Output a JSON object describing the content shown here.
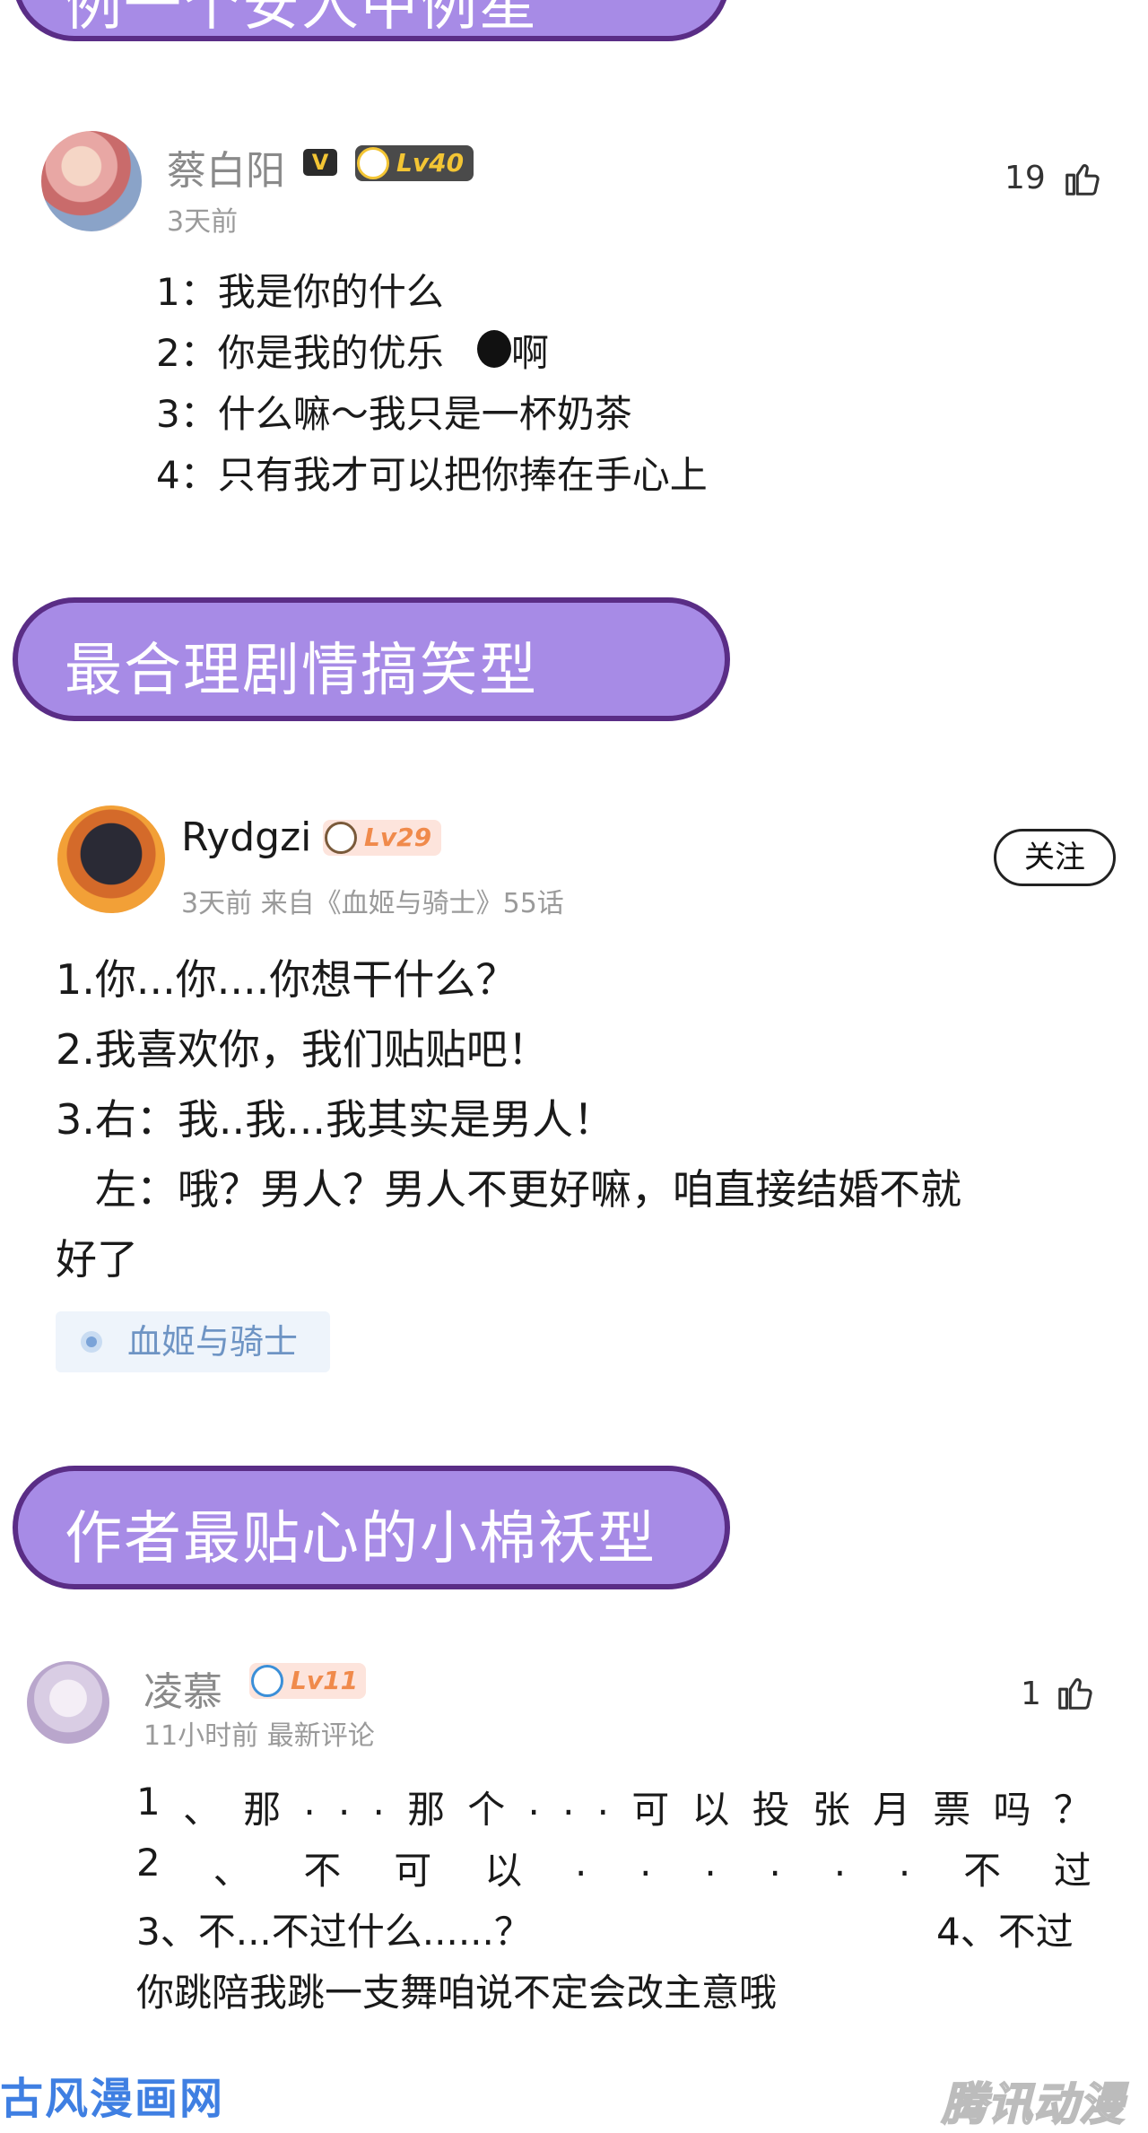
{
  "banners": {
    "top": "例一个安人中例星",
    "b1": "最合理剧情搞笑型",
    "b2": "作者最贴心的小棉袄型"
  },
  "comment1": {
    "username": "蔡白阳",
    "v_badge": "V",
    "level": "Lv40",
    "time": "3天前",
    "likes": "19",
    "lines": [
      "1：我是你的什么",
      "2：你是我的优乐",
      "啊",
      "3：什么嘛～我只是一杯奶茶",
      "4：只有我才可以把你捧在手心上"
    ]
  },
  "comment2": {
    "username": "Rydgzi",
    "level": "Lv29",
    "meta": "3天前 来自《血姬与骑士》55话",
    "follow": "关注",
    "lines": [
      "1.你...你....你想干什么？",
      "2.我喜欢你，我们贴贴吧！",
      "3.右：我..我...我其实是男人！",
      "左：哦？男人？男人不更好嘛，咱直接结婚不就",
      "好了"
    ],
    "tag": "血姬与骑士"
  },
  "comment3": {
    "username": "凌慕",
    "level": "Lv11",
    "meta": "11小时前 最新评论",
    "likes": "1",
    "row1": [
      "1",
      "、",
      "那",
      ".",
      ".",
      ".",
      "那",
      "个",
      ".",
      ".",
      ".",
      "可",
      "以",
      "投",
      "张",
      "月",
      "票",
      "吗",
      "？"
    ],
    "row2": [
      "2",
      "、",
      "不",
      "可",
      "以",
      ".",
      ".",
      ".",
      ".",
      ".",
      ".",
      "不",
      "过"
    ],
    "row3_left": "3、不...不过什么......？",
    "row3_right": "4、不过",
    "row4": "你跳陪我跳一支舞咱说不定会改主意哦"
  },
  "watermarks": {
    "left": "古风漫画网",
    "right": "腾讯动漫"
  },
  "colors": {
    "banner_fill": "#a78be6",
    "banner_border": "#5a2d86",
    "tag_text": "#6e94c4",
    "level_orange": "#f08a4b"
  }
}
